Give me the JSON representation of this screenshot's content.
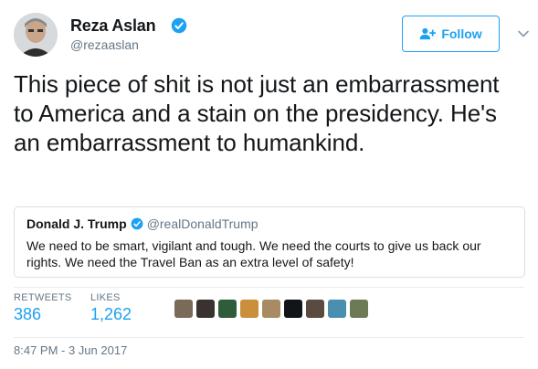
{
  "author": {
    "name": "Reza Aslan",
    "handle": "@rezaaslan",
    "verified": true
  },
  "follow_button": {
    "label": "Follow",
    "icon": "person-plus-icon"
  },
  "menu_icon": "chevron-down-icon",
  "tweet": {
    "text": "This piece of shit is not just an embarrassment to America and a stain on the presidency. He's an embarrassment to humankind."
  },
  "quoted_tweet": {
    "name": "Donald J. Trump",
    "handle": "@realDonaldTrump",
    "verified": true,
    "text": "We need to be smart, vigilant and tough. We need the courts to give us back our rights. We need the Travel Ban as an extra level of safety!"
  },
  "stats": {
    "retweets_label": "RETWEETS",
    "retweets": "386",
    "likes_label": "LIKES",
    "likes": "1,262"
  },
  "timestamp": "8:47 PM - 3 Jun 2017",
  "colors": {
    "accent": "#1da1f2",
    "text": "#14171a",
    "muted": "#657786",
    "border": "#e6ecf0"
  },
  "liker_avatars": [
    {
      "color": "#7a6a58"
    },
    {
      "color": "#3a3230"
    },
    {
      "color": "#2f5d3a"
    },
    {
      "color": "#c98f3a"
    },
    {
      "color": "#a88b62"
    },
    {
      "color": "#111418"
    },
    {
      "color": "#5b4a40"
    },
    {
      "color": "#4a8fb0"
    },
    {
      "color": "#6c7a56"
    }
  ]
}
